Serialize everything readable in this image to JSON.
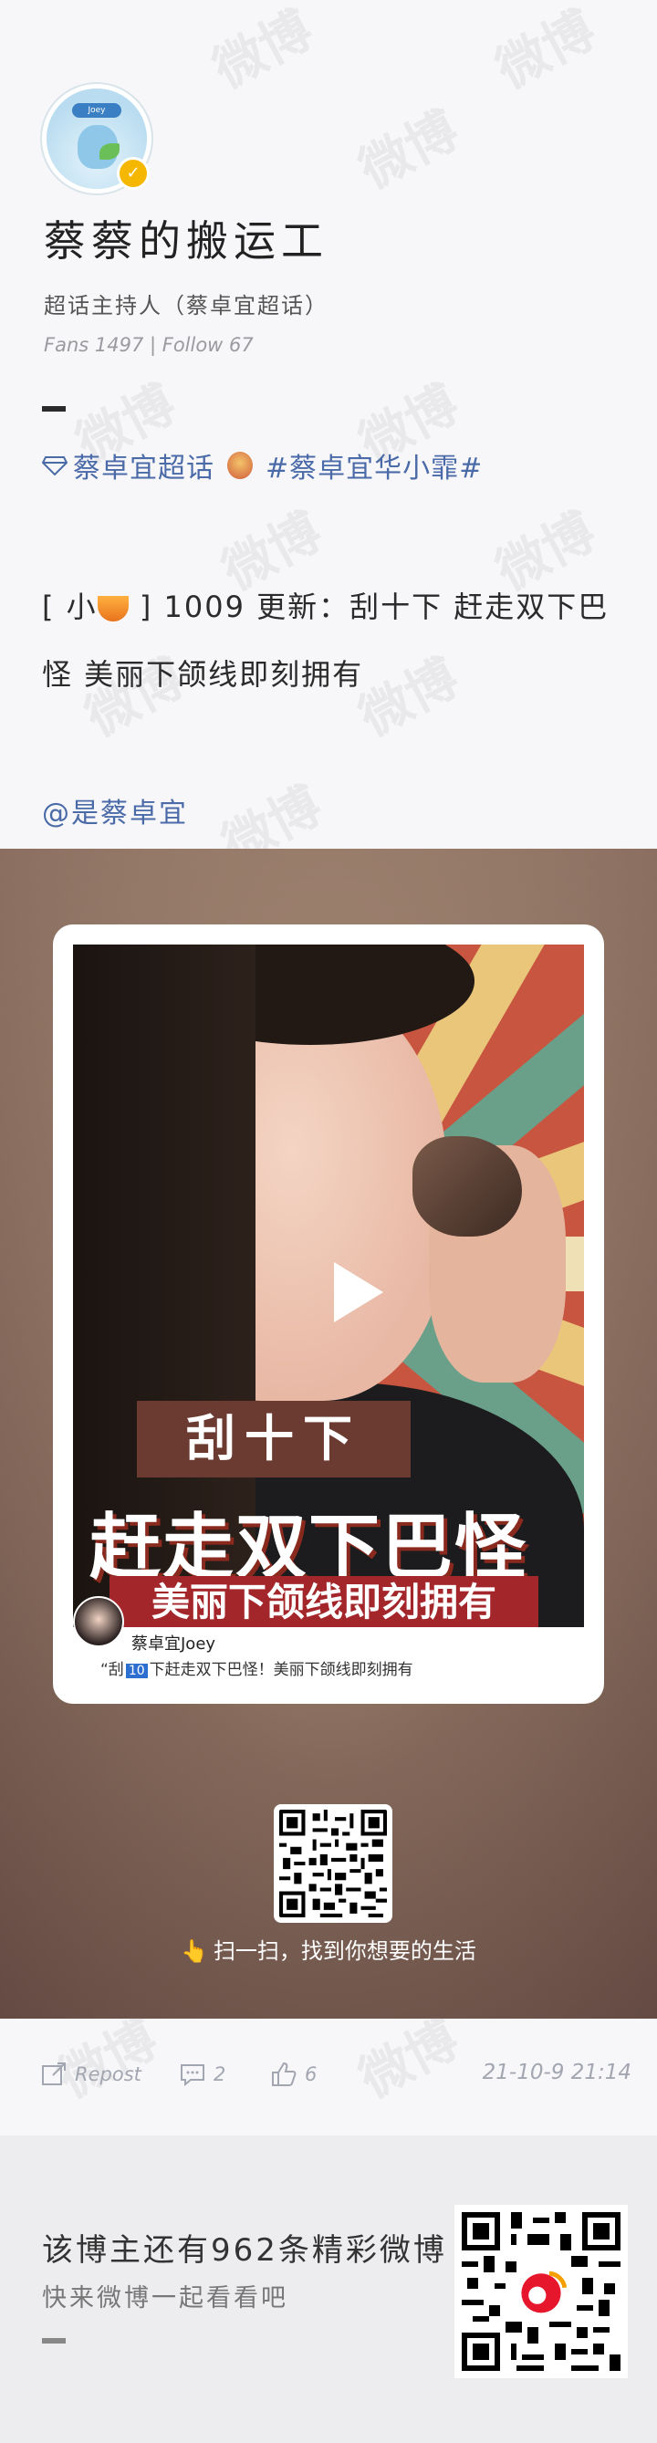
{
  "profile": {
    "avatar_label": "Joey",
    "username": "蔡蔡的搬运工",
    "role": "超话主持人（蔡卓宜超话）",
    "stats": "Fans 1497 | Follow 67"
  },
  "post": {
    "tag1": "蔡卓宜超话",
    "tag2": "#蔡卓宜华小霏#",
    "text_prefix": "[ 小",
    "text_body": " ] 1009 更新：刮十下 赶走双下巴怪 美丽下颌线即刻拥有",
    "mention": "@是蔡卓宜"
  },
  "video": {
    "title_small": "刮十下",
    "title_big": "赶走双下巴怪",
    "title_sub": "美丽下颌线即刻拥有",
    "author": "蔡卓宜Joey",
    "desc_prefix": "“刮",
    "desc_num": "10",
    "desc_suffix": "下赶走双下巴怪！美丽下颌线即刻拥有"
  },
  "scan": {
    "text": "扫一扫，找到你想要的生活"
  },
  "actions": {
    "repost": "Repost",
    "comments": "2",
    "likes": "6",
    "time": "21-10-9 21:14"
  },
  "footer": {
    "main": "该博主还有962条精彩微博",
    "sub": "快来微博一起看看吧"
  },
  "watermark": "微博",
  "colors": {
    "link": "#4b6aa8",
    "verified": "#f5b700"
  }
}
